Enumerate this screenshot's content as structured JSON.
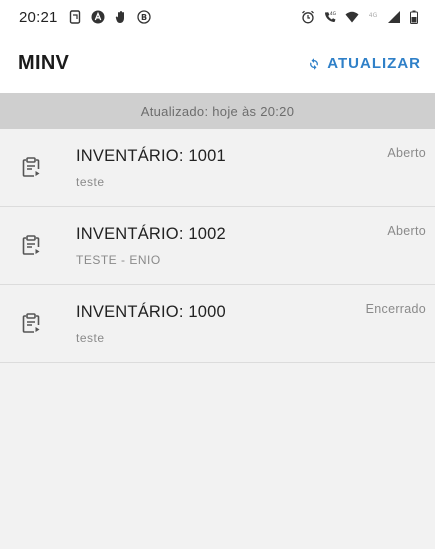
{
  "status_bar": {
    "time": "20:21",
    "left_icons": [
      "screenshot-icon",
      "app-a-icon",
      "hand-icon",
      "b-circle-icon"
    ],
    "right_icons": [
      "alarm-icon",
      "call-4g-icon",
      "wifi-icon",
      "signal-4g-icon",
      "signal-bars-icon",
      "battery-icon"
    ],
    "signal_label_1": "4G",
    "signal_label_2": "4G"
  },
  "app_bar": {
    "title": "MINV",
    "refresh_label": "ATUALIZAR",
    "refresh_icon": "refresh-icon"
  },
  "updated_banner": {
    "text": "Atualizado: hoje às 20:20"
  },
  "inventories": [
    {
      "title": "INVENTÁRIO: 1001",
      "subtitle": "teste",
      "status": "Aberto",
      "icon": "clipboard-icon"
    },
    {
      "title": "INVENTÁRIO: 1002",
      "subtitle": "TESTE - ENIO",
      "status": "Aberto",
      "icon": "clipboard-icon"
    },
    {
      "title": "INVENTÁRIO: 1000",
      "subtitle": "teste",
      "status": "Encerrado",
      "icon": "clipboard-icon"
    }
  ],
  "colors": {
    "accent": "#2f80c8",
    "banner_bg": "#cfcfcf",
    "page_bg": "#f2f2f2"
  }
}
